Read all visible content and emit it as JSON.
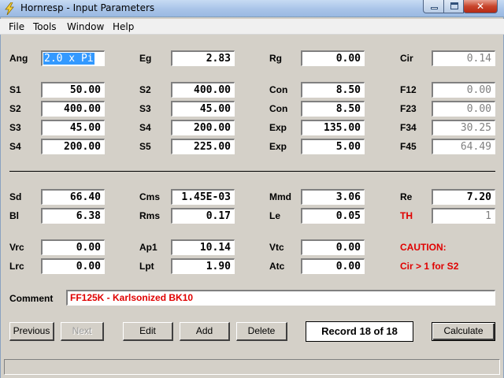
{
  "window": {
    "title": "Hornresp - Input Parameters"
  },
  "menu": [
    "File",
    "Tools",
    "Window",
    "Help"
  ],
  "fields": {
    "Ang": "2.0 x Pi",
    "Eg": "2.83",
    "Rg": "0.00",
    "Cir": "0.14",
    "S1": "50.00",
    "S2_a": "400.00",
    "Con_1": "8.50",
    "F12": "0.00",
    "S2_b": "400.00",
    "S3_a": "45.00",
    "Con_2": "8.50",
    "F23": "0.00",
    "S3_b": "45.00",
    "S4_a": "200.00",
    "Exp_1": "135.00",
    "F34": "30.25",
    "S4_b": "200.00",
    "S5": "225.00",
    "Exp_2": "5.00",
    "F45": "64.49",
    "Sd": "66.40",
    "Cms": "1.45E-03",
    "Mmd": "3.06",
    "Re": "7.20",
    "Bl": "6.38",
    "Rms": "0.17",
    "Le": "0.05",
    "TH": "1",
    "Vrc": "0.00",
    "Ap1": "10.14",
    "Vtc": "0.00",
    "Lrc": "0.00",
    "Lpt": "1.90",
    "Atc": "0.00"
  },
  "labels": {
    "Ang": "Ang",
    "Eg": "Eg",
    "Rg": "Rg",
    "Cir": "Cir",
    "S1": "S1",
    "S2": "S2",
    "S3": "S3",
    "S4": "S4",
    "S5": "S5",
    "Con": "Con",
    "Exp": "Exp",
    "F12": "F12",
    "F23": "F23",
    "F34": "F34",
    "F45": "F45",
    "Sd": "Sd",
    "Cms": "Cms",
    "Mmd": "Mmd",
    "Re": "Re",
    "Bl": "Bl",
    "Rms": "Rms",
    "Le": "Le",
    "TH": "TH",
    "Vrc": "Vrc",
    "Ap1": "Ap1",
    "Vtc": "Vtc",
    "Lrc": "Lrc",
    "Lpt": "Lpt",
    "Atc": "Atc",
    "Comment": "Comment"
  },
  "caution": {
    "title": "CAUTION:",
    "message": "Cir > 1 for S2"
  },
  "comment": "FF125K - Karlsonized BK10",
  "buttons": {
    "previous": "Previous",
    "next": "Next",
    "edit": "Edit",
    "add": "Add",
    "delete": "Delete",
    "calculate": "Calculate"
  },
  "record": "Record 18 of 18",
  "colors": {
    "warning": "#e00000",
    "selection": "#3399ff",
    "face": "#d4d0c8"
  }
}
